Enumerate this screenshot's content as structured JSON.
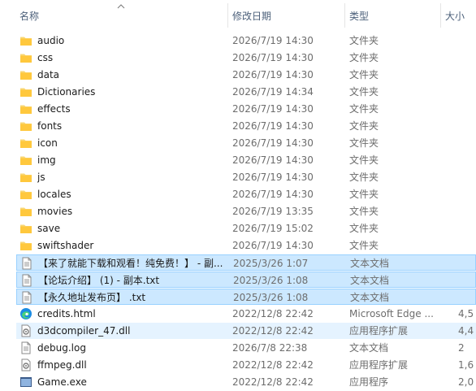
{
  "columns": {
    "name": "名称",
    "date": "修改日期",
    "type": "类型",
    "size": "大小"
  },
  "rows": [
    {
      "name": "audio",
      "date": "2026/7/19 14:30",
      "type": "文件夹",
      "size": "",
      "icon": "folder-icon",
      "state": ""
    },
    {
      "name": "css",
      "date": "2026/7/19 14:30",
      "type": "文件夹",
      "size": "",
      "icon": "folder-icon",
      "state": ""
    },
    {
      "name": "data",
      "date": "2026/7/19 14:30",
      "type": "文件夹",
      "size": "",
      "icon": "folder-icon",
      "state": ""
    },
    {
      "name": "Dictionaries",
      "date": "2026/7/19 14:34",
      "type": "文件夹",
      "size": "",
      "icon": "folder-icon",
      "state": ""
    },
    {
      "name": "effects",
      "date": "2026/7/19 14:30",
      "type": "文件夹",
      "size": "",
      "icon": "folder-icon",
      "state": ""
    },
    {
      "name": "fonts",
      "date": "2026/7/19 14:30",
      "type": "文件夹",
      "size": "",
      "icon": "folder-icon",
      "state": ""
    },
    {
      "name": "icon",
      "date": "2026/7/19 14:30",
      "type": "文件夹",
      "size": "",
      "icon": "folder-icon",
      "state": ""
    },
    {
      "name": "img",
      "date": "2026/7/19 14:30",
      "type": "文件夹",
      "size": "",
      "icon": "folder-icon",
      "state": ""
    },
    {
      "name": "js",
      "date": "2026/7/19 14:30",
      "type": "文件夹",
      "size": "",
      "icon": "folder-icon",
      "state": ""
    },
    {
      "name": "locales",
      "date": "2026/7/19 14:30",
      "type": "文件夹",
      "size": "",
      "icon": "folder-icon",
      "state": ""
    },
    {
      "name": "movies",
      "date": "2026/7/19 13:35",
      "type": "文件夹",
      "size": "",
      "icon": "folder-icon",
      "state": ""
    },
    {
      "name": "save",
      "date": "2026/7/19 15:02",
      "type": "文件夹",
      "size": "",
      "icon": "folder-icon",
      "state": ""
    },
    {
      "name": "swiftshader",
      "date": "2026/7/19 14:30",
      "type": "文件夹",
      "size": "",
      "icon": "folder-icon",
      "state": ""
    },
    {
      "name": "【来了就能下载和观看！纯免费！】 - 副...",
      "date": "2025/3/26 1:07",
      "type": "文本文档",
      "size": "",
      "icon": "text-file-icon",
      "state": "sel"
    },
    {
      "name": "【论坛介绍】 (1) - 副本.txt",
      "date": "2025/3/26 1:08",
      "type": "文本文档",
      "size": "",
      "icon": "text-file-icon",
      "state": "sel"
    },
    {
      "name": "【永久地址发布页】 .txt",
      "date": "2025/3/26 1:08",
      "type": "文本文档",
      "size": "",
      "icon": "text-file-icon",
      "state": "sel"
    },
    {
      "name": "credits.html",
      "date": "2022/12/8 22:42",
      "type": "Microsoft Edge ...",
      "size": "4,5",
      "icon": "edge-icon",
      "state": ""
    },
    {
      "name": "d3dcompiler_47.dll",
      "date": "2022/12/8 22:42",
      "type": "应用程序扩展",
      "size": "4,4",
      "icon": "dll-file-icon",
      "state": "hover"
    },
    {
      "name": "debug.log",
      "date": "2026/7/8 22:38",
      "type": "文本文档",
      "size": "2",
      "icon": "text-file-icon",
      "state": ""
    },
    {
      "name": "ffmpeg.dll",
      "date": "2022/12/8 22:42",
      "type": "应用程序扩展",
      "size": "1,6",
      "icon": "dll-file-icon",
      "state": ""
    },
    {
      "name": "Game.exe",
      "date": "2022/12/8 22:42",
      "type": "应用程序",
      "size": "2,0",
      "icon": "exe-icon",
      "state": ""
    }
  ]
}
